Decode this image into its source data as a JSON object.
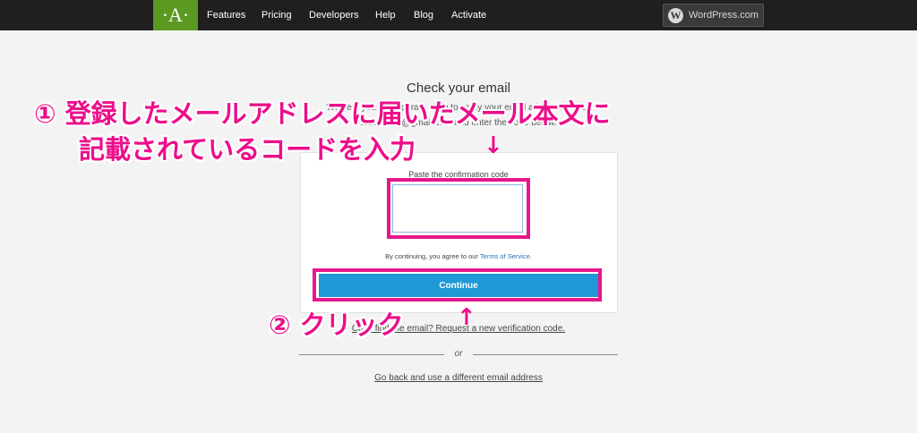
{
  "navbar": {
    "logo_text": "·A·",
    "items": [
      {
        "label": "Features"
      },
      {
        "label": "Pricing"
      },
      {
        "label": "Developers"
      },
      {
        "label": "Help"
      },
      {
        "label": "Blog"
      },
      {
        "label": "Activate"
      }
    ],
    "wordpress_button": {
      "icon": "wordpress-icon",
      "label": "WordPress.com"
    }
  },
  "main": {
    "title": "Check your email",
    "instructions_line1": "We sent you a temporary code to verify your email address. Check",
    "instructions_line2": "todojoblog@gmail.com and enter the code below.",
    "code_label": "Paste the confirmation code",
    "code_value": "",
    "tos_prefix": "By continuing, you agree to our ",
    "tos_link": "Terms of Service",
    "tos_suffix": ".",
    "continue_label": "Continue",
    "resend_link": "Can't find the email? Request a new verification code.",
    "or_text": "or",
    "back_link": "Go back and use a different email address"
  },
  "annotations": {
    "step1_line1": "① 登録したメールアドレスに届いたメール本文に",
    "step1_line2": "記載されているコードを入力",
    "step2": "② クリック",
    "arrow_down": "↓",
    "arrow_up": "↑",
    "color": "#ec0e8a"
  },
  "colors": {
    "nav_bg": "#1f1f1f",
    "logo_bg": "#5c9921",
    "button_bg": "#1f99d6",
    "link": "#2271b1"
  }
}
